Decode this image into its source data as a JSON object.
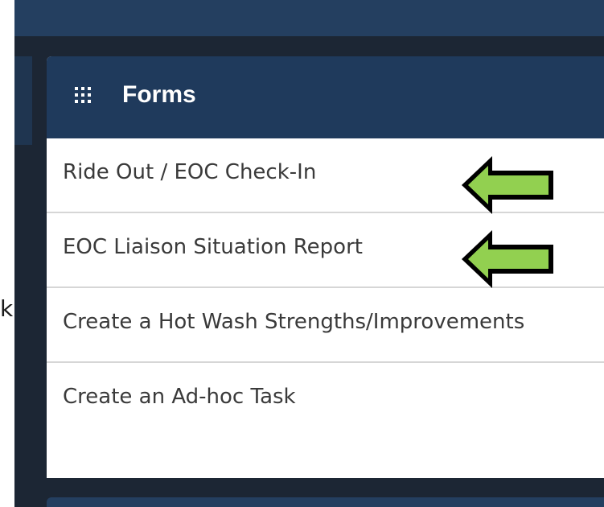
{
  "stray_text": "k",
  "panel": {
    "title": "Forms",
    "header_icon": "grid-icon"
  },
  "forms": [
    {
      "label": "Ride Out / EOC Check-In",
      "highlighted": true
    },
    {
      "label": "EOC Liaison Situation Report",
      "highlighted": true
    },
    {
      "label": "Create a Hot Wash Strengths/Improvements",
      "highlighted": false
    },
    {
      "label": "Create an Ad-hoc Task",
      "highlighted": false
    }
  ],
  "annotations": {
    "arrow_icon": "left-arrow-icon",
    "arrow_color": "#92d050",
    "arrow_outline": "#000000"
  },
  "colors": {
    "top_bar": "#243f60",
    "panel_header": "#1f3a5c",
    "shell_background": "#1c2634",
    "item_text": "#3a3a3a",
    "divider": "#d6d6d6"
  }
}
